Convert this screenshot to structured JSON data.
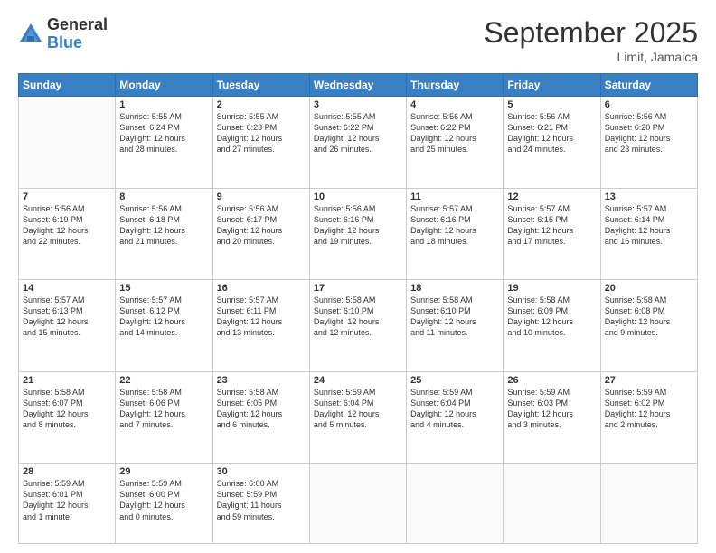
{
  "header": {
    "logo_general": "General",
    "logo_blue": "Blue",
    "month_title": "September 2025",
    "location": "Limit, Jamaica"
  },
  "days_of_week": [
    "Sunday",
    "Monday",
    "Tuesday",
    "Wednesday",
    "Thursday",
    "Friday",
    "Saturday"
  ],
  "weeks": [
    [
      {
        "day": "",
        "info": ""
      },
      {
        "day": "1",
        "info": "Sunrise: 5:55 AM\nSunset: 6:24 PM\nDaylight: 12 hours\nand 28 minutes."
      },
      {
        "day": "2",
        "info": "Sunrise: 5:55 AM\nSunset: 6:23 PM\nDaylight: 12 hours\nand 27 minutes."
      },
      {
        "day": "3",
        "info": "Sunrise: 5:55 AM\nSunset: 6:22 PM\nDaylight: 12 hours\nand 26 minutes."
      },
      {
        "day": "4",
        "info": "Sunrise: 5:56 AM\nSunset: 6:22 PM\nDaylight: 12 hours\nand 25 minutes."
      },
      {
        "day": "5",
        "info": "Sunrise: 5:56 AM\nSunset: 6:21 PM\nDaylight: 12 hours\nand 24 minutes."
      },
      {
        "day": "6",
        "info": "Sunrise: 5:56 AM\nSunset: 6:20 PM\nDaylight: 12 hours\nand 23 minutes."
      }
    ],
    [
      {
        "day": "7",
        "info": "Sunrise: 5:56 AM\nSunset: 6:19 PM\nDaylight: 12 hours\nand 22 minutes."
      },
      {
        "day": "8",
        "info": "Sunrise: 5:56 AM\nSunset: 6:18 PM\nDaylight: 12 hours\nand 21 minutes."
      },
      {
        "day": "9",
        "info": "Sunrise: 5:56 AM\nSunset: 6:17 PM\nDaylight: 12 hours\nand 20 minutes."
      },
      {
        "day": "10",
        "info": "Sunrise: 5:56 AM\nSunset: 6:16 PM\nDaylight: 12 hours\nand 19 minutes."
      },
      {
        "day": "11",
        "info": "Sunrise: 5:57 AM\nSunset: 6:16 PM\nDaylight: 12 hours\nand 18 minutes."
      },
      {
        "day": "12",
        "info": "Sunrise: 5:57 AM\nSunset: 6:15 PM\nDaylight: 12 hours\nand 17 minutes."
      },
      {
        "day": "13",
        "info": "Sunrise: 5:57 AM\nSunset: 6:14 PM\nDaylight: 12 hours\nand 16 minutes."
      }
    ],
    [
      {
        "day": "14",
        "info": "Sunrise: 5:57 AM\nSunset: 6:13 PM\nDaylight: 12 hours\nand 15 minutes."
      },
      {
        "day": "15",
        "info": "Sunrise: 5:57 AM\nSunset: 6:12 PM\nDaylight: 12 hours\nand 14 minutes."
      },
      {
        "day": "16",
        "info": "Sunrise: 5:57 AM\nSunset: 6:11 PM\nDaylight: 12 hours\nand 13 minutes."
      },
      {
        "day": "17",
        "info": "Sunrise: 5:58 AM\nSunset: 6:10 PM\nDaylight: 12 hours\nand 12 minutes."
      },
      {
        "day": "18",
        "info": "Sunrise: 5:58 AM\nSunset: 6:10 PM\nDaylight: 12 hours\nand 11 minutes."
      },
      {
        "day": "19",
        "info": "Sunrise: 5:58 AM\nSunset: 6:09 PM\nDaylight: 12 hours\nand 10 minutes."
      },
      {
        "day": "20",
        "info": "Sunrise: 5:58 AM\nSunset: 6:08 PM\nDaylight: 12 hours\nand 9 minutes."
      }
    ],
    [
      {
        "day": "21",
        "info": "Sunrise: 5:58 AM\nSunset: 6:07 PM\nDaylight: 12 hours\nand 8 minutes."
      },
      {
        "day": "22",
        "info": "Sunrise: 5:58 AM\nSunset: 6:06 PM\nDaylight: 12 hours\nand 7 minutes."
      },
      {
        "day": "23",
        "info": "Sunrise: 5:58 AM\nSunset: 6:05 PM\nDaylight: 12 hours\nand 6 minutes."
      },
      {
        "day": "24",
        "info": "Sunrise: 5:59 AM\nSunset: 6:04 PM\nDaylight: 12 hours\nand 5 minutes."
      },
      {
        "day": "25",
        "info": "Sunrise: 5:59 AM\nSunset: 6:04 PM\nDaylight: 12 hours\nand 4 minutes."
      },
      {
        "day": "26",
        "info": "Sunrise: 5:59 AM\nSunset: 6:03 PM\nDaylight: 12 hours\nand 3 minutes."
      },
      {
        "day": "27",
        "info": "Sunrise: 5:59 AM\nSunset: 6:02 PM\nDaylight: 12 hours\nand 2 minutes."
      }
    ],
    [
      {
        "day": "28",
        "info": "Sunrise: 5:59 AM\nSunset: 6:01 PM\nDaylight: 12 hours\nand 1 minute."
      },
      {
        "day": "29",
        "info": "Sunrise: 5:59 AM\nSunset: 6:00 PM\nDaylight: 12 hours\nand 0 minutes."
      },
      {
        "day": "30",
        "info": "Sunrise: 6:00 AM\nSunset: 5:59 PM\nDaylight: 11 hours\nand 59 minutes."
      },
      {
        "day": "",
        "info": ""
      },
      {
        "day": "",
        "info": ""
      },
      {
        "day": "",
        "info": ""
      },
      {
        "day": "",
        "info": ""
      }
    ]
  ]
}
